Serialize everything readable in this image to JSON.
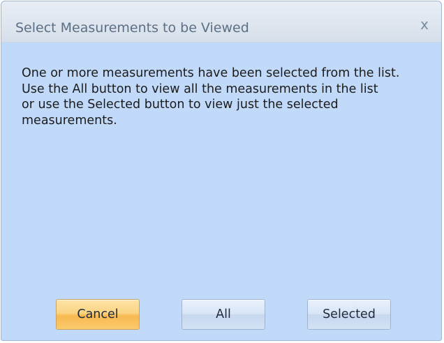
{
  "dialog": {
    "title": "Select Measurements to be Viewed",
    "close_glyph": "x",
    "message_lines": [
      "One or more measurements have been selected from the list.",
      "Use the All button to view all the measurements in the list",
      "or use the Selected button to view just the selected",
      "measurements."
    ]
  },
  "buttons": {
    "cancel_label": "Cancel",
    "all_label": "All",
    "selected_label": "Selected"
  },
  "colors": {
    "dialog_background": "#c2dafa",
    "focused_button": "#fbd483"
  },
  "icons": {
    "close": "close-icon"
  }
}
